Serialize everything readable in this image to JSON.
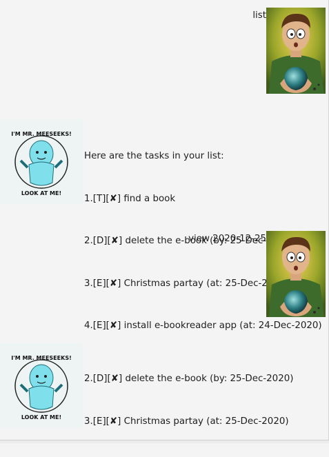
{
  "conversation": [
    {
      "from": "user",
      "text": "list"
    },
    {
      "from": "duke",
      "lines": [
        "Here are the tasks in your list:",
        "1.[T][✘] find a book",
        "2.[D][✘] delete the e-book (by: 25-Dec-2020)",
        "3.[E][✘] Christmas partay (at: 25-Dec-2020)",
        "4.[E][✘] install e-bookreader app (at: 24-Dec-2020)"
      ]
    },
    {
      "from": "user",
      "text": "view 2020-12-25"
    },
    {
      "from": "duke",
      "lines": [
        "2.[D][✘] delete the e-book (by: 25-Dec-2020)",
        "3.[E][✘] Christmas partay (at: 25-Dec-2020)"
      ]
    }
  ],
  "avatars": {
    "duke_badge_text_top": "I'M MR. MEESEEKS!",
    "duke_badge_text_bottom": "LOOK AT ME!"
  }
}
